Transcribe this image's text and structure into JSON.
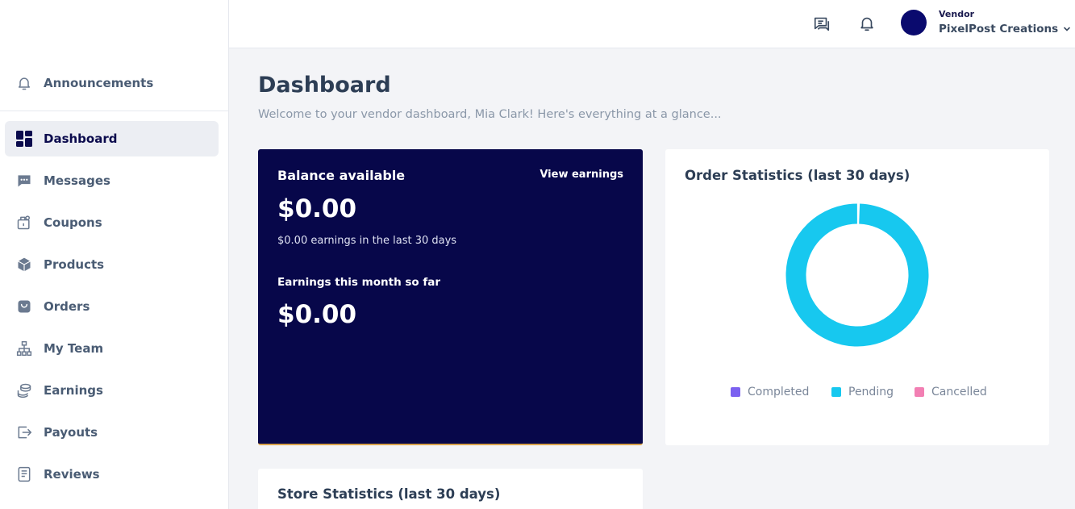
{
  "sidebar": {
    "items": [
      {
        "label": "Announcements",
        "icon": "bell-icon"
      },
      {
        "label": "Dashboard",
        "icon": "dashboard-icon",
        "active": true
      },
      {
        "label": "Messages",
        "icon": "chat-icon"
      },
      {
        "label": "Coupons",
        "icon": "coupon-icon"
      },
      {
        "label": "Products",
        "icon": "box-icon"
      },
      {
        "label": "Orders",
        "icon": "bag-icon"
      },
      {
        "label": "My Team",
        "icon": "org-chart-icon"
      },
      {
        "label": "Earnings",
        "icon": "coins-icon"
      },
      {
        "label": "Payouts",
        "icon": "export-icon"
      },
      {
        "label": "Reviews",
        "icon": "document-icon"
      }
    ]
  },
  "header": {
    "vendor_role": "Vendor",
    "vendor_name": "PixelPost Creations"
  },
  "main": {
    "title": "Dashboard",
    "subtitle": "Welcome to your vendor dashboard, Mia Clark! Here's everything at a glance..."
  },
  "balance": {
    "title": "Balance available",
    "link": "View earnings",
    "amount": "$0.00",
    "note": "$0.00 earnings in the last 30 days",
    "month_label": "Earnings this month so far",
    "month_amount": "$0.00"
  },
  "order_stats": {
    "title": "Order Statistics (last 30 days)",
    "legend": [
      {
        "label": "Completed",
        "color": "#7b61f0"
      },
      {
        "label": "Pending",
        "color": "#17c8ef"
      },
      {
        "label": "Cancelled",
        "color": "#f27fb3"
      }
    ]
  },
  "chart_data": {
    "type": "pie",
    "categories": [
      "Completed",
      "Pending",
      "Cancelled"
    ],
    "values": [
      0,
      1,
      0
    ],
    "colors": [
      "#7b61f0",
      "#17c8ef",
      "#f27fb3"
    ]
  },
  "store_stats": {
    "title": "Store Statistics (last 30 days)"
  },
  "colors": {
    "brand_dark": "#07074a",
    "accent_cyan": "#17c8ef",
    "page_bg": "#f3f4f7"
  }
}
